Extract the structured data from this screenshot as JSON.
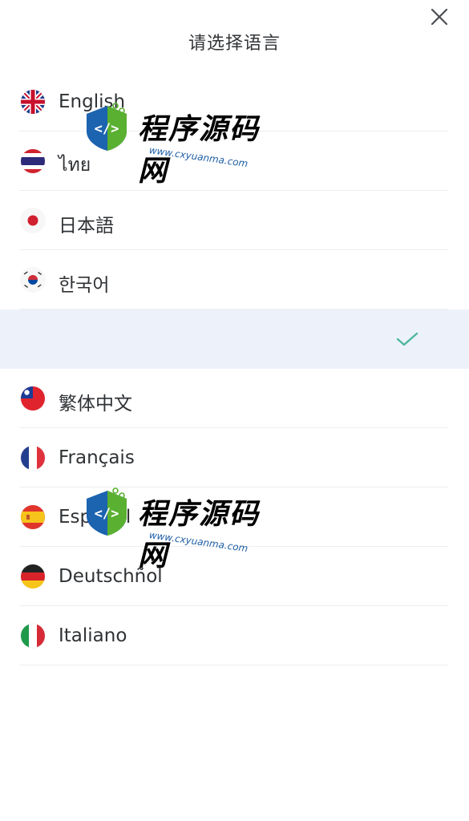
{
  "header": {
    "title": "请选择语言",
    "close_icon": "close-icon"
  },
  "languages": [
    {
      "label": "English",
      "flag": "uk-flag-icon",
      "selected": false
    },
    {
      "label": "ไทย",
      "flag": "thailand-flag-icon",
      "selected": false
    },
    {
      "label": "日本語",
      "flag": "japan-flag-icon",
      "selected": false
    },
    {
      "label": "한국어",
      "flag": "korea-flag-icon",
      "selected": false
    },
    {
      "label": "",
      "flag": "",
      "selected": true
    },
    {
      "label": "繁体中文",
      "flag": "taiwan-flag-icon",
      "selected": false
    },
    {
      "label": "Français",
      "flag": "france-flag-icon",
      "selected": false
    },
    {
      "label": "Español",
      "flag": "spain-flag-icon",
      "selected": false
    },
    {
      "label": "Deutschñol",
      "flag": "germany-flag-icon",
      "selected": false
    },
    {
      "label": "Italiano",
      "flag": "italy-flag-icon",
      "selected": false
    }
  ],
  "watermark": {
    "brand": "程序源码网",
    "url": "www.cxyuanma.com"
  },
  "colors": {
    "selected_background": "#edf2fa",
    "check": "#4fb6a0",
    "text": "#2f3235",
    "divider": "#eceef1",
    "watermark_blue": "#1c63b0",
    "watermark_green": "#5ab030"
  }
}
